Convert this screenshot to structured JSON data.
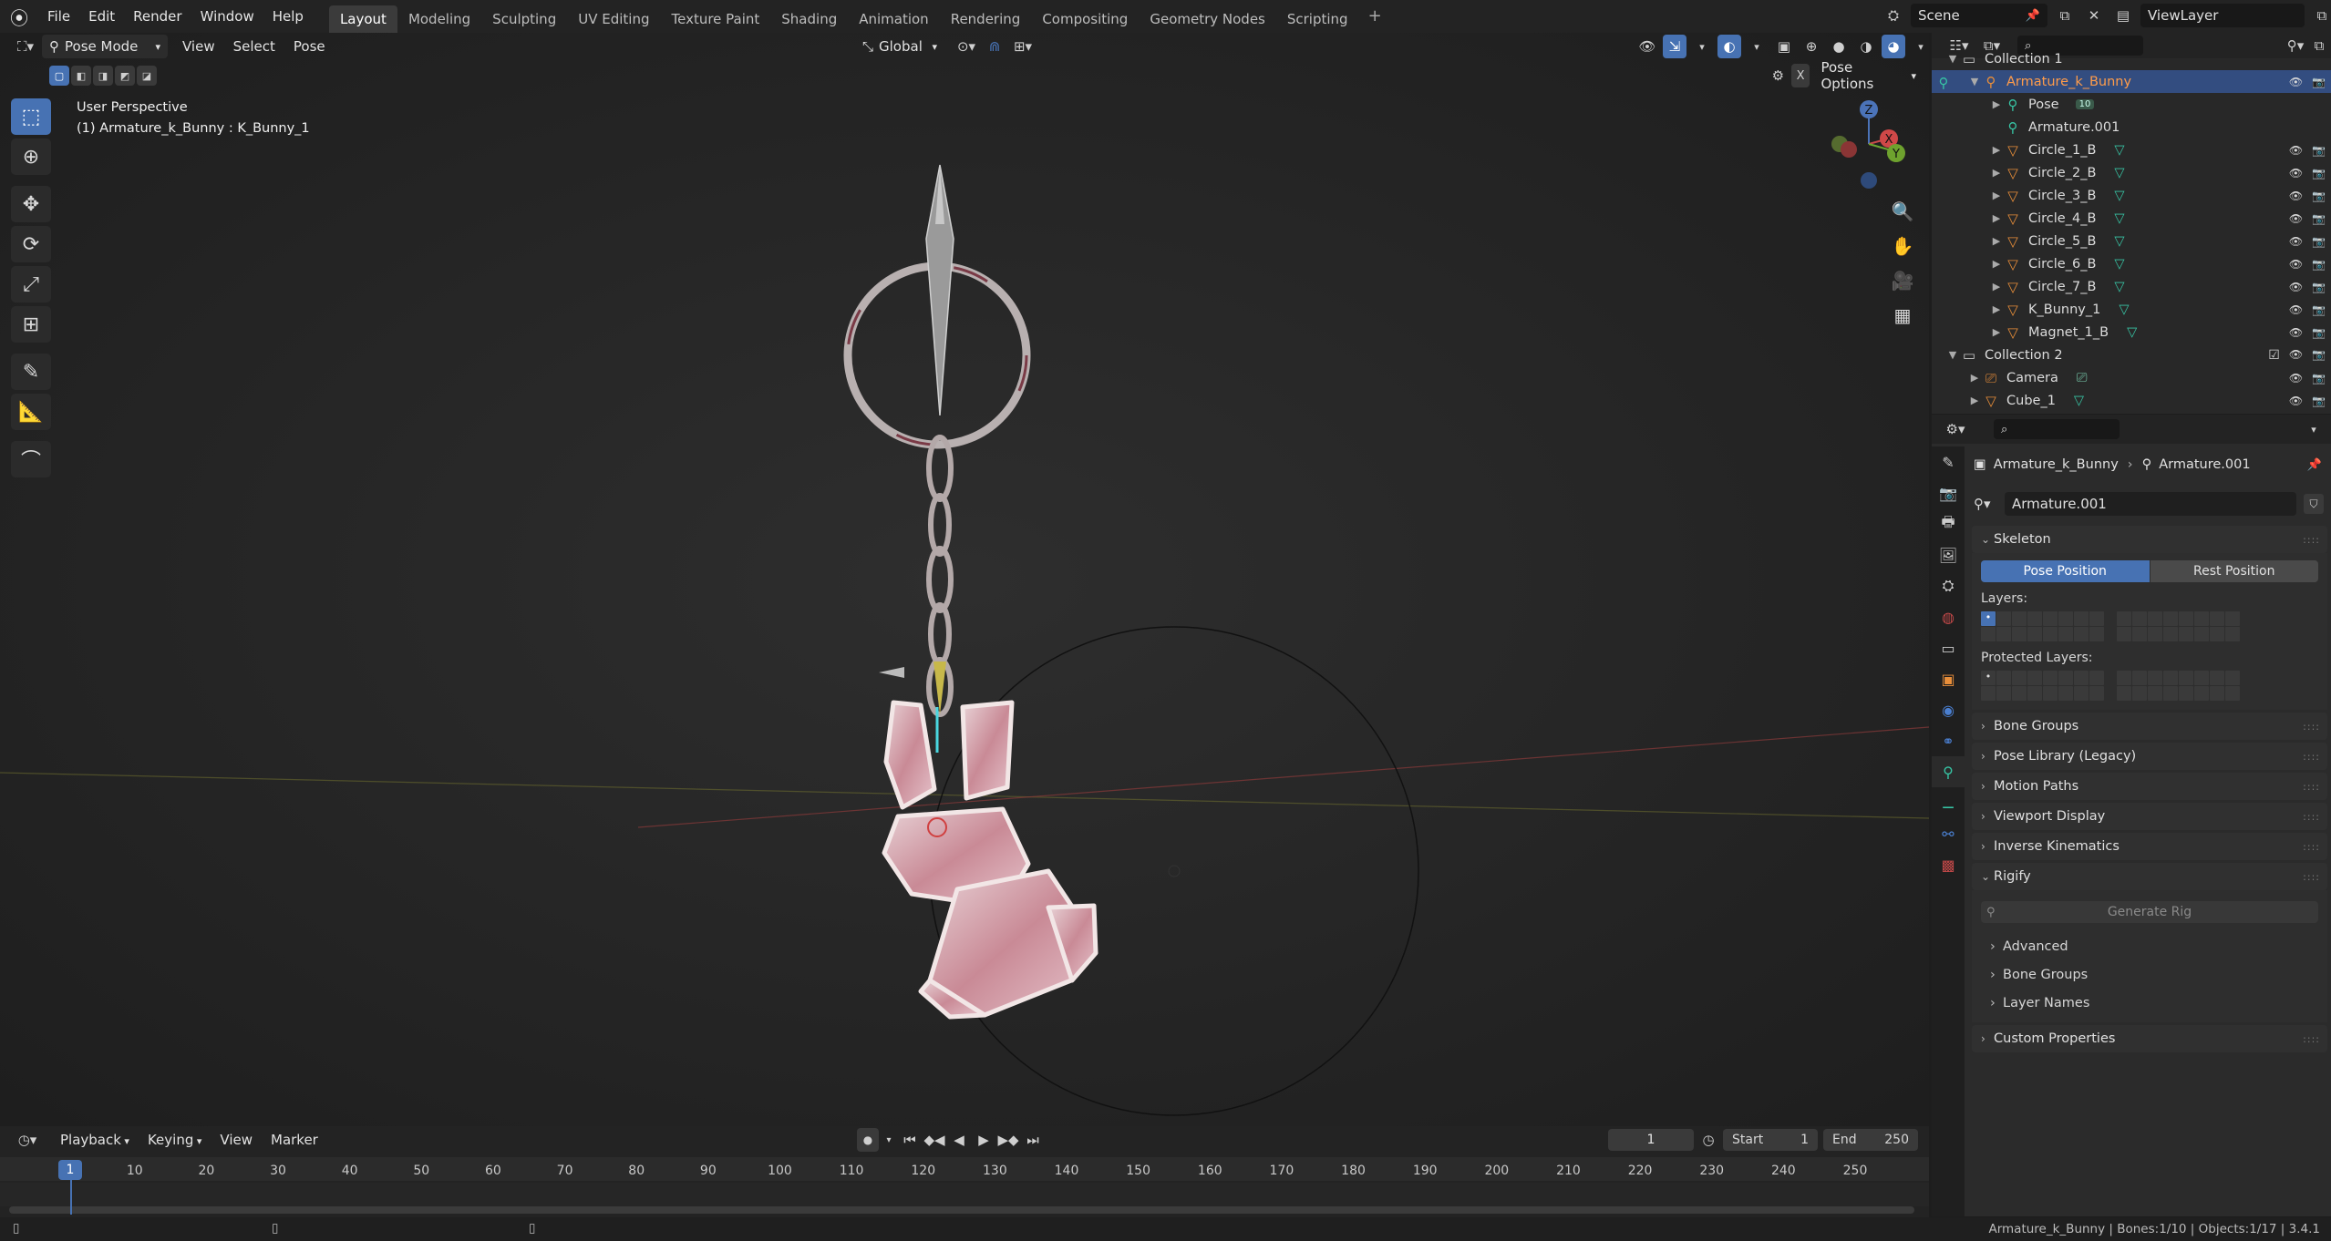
{
  "top_menu": {
    "app_menus": [
      "File",
      "Edit",
      "Render",
      "Window",
      "Help"
    ],
    "workspaces": [
      "Layout",
      "Modeling",
      "Sculpting",
      "UV Editing",
      "Texture Paint",
      "Shading",
      "Animation",
      "Rendering",
      "Compositing",
      "Geometry Nodes",
      "Scripting"
    ],
    "active_workspace": "Layout",
    "add_workspace": "+",
    "scene": "Scene",
    "view_layer": "ViewLayer"
  },
  "viewport": {
    "mode": "Pose Mode",
    "menus": [
      "View",
      "Select",
      "Pose"
    ],
    "orientation": "Global",
    "pose_options": "Pose Options",
    "overlay_title": "User Perspective",
    "overlay_sub": "(1) Armature_k_Bunny : K_Bunny_1",
    "gizmo_axes": {
      "z": "Z",
      "x": "X",
      "y": "Y"
    },
    "x_close": "X"
  },
  "outliner": {
    "items": [
      {
        "label": "Collection 1",
        "indent": 1,
        "icon": "collection"
      },
      {
        "label": "Armature_k_Bunny",
        "indent": 2,
        "icon": "armature",
        "selected": true
      },
      {
        "label": "Pose",
        "indent": 3,
        "icon": "pose",
        "badge": "10"
      },
      {
        "label": "Armature.001",
        "indent": 3,
        "icon": "armature-data"
      },
      {
        "label": "Circle_1_B",
        "indent": 3,
        "icon": "mesh"
      },
      {
        "label": "Circle_2_B",
        "indent": 3,
        "icon": "mesh"
      },
      {
        "label": "Circle_3_B",
        "indent": 3,
        "icon": "mesh"
      },
      {
        "label": "Circle_4_B",
        "indent": 3,
        "icon": "mesh"
      },
      {
        "label": "Circle_5_B",
        "indent": 3,
        "icon": "mesh"
      },
      {
        "label": "Circle_6_B",
        "indent": 3,
        "icon": "mesh"
      },
      {
        "label": "Circle_7_B",
        "indent": 3,
        "icon": "mesh"
      },
      {
        "label": "K_Bunny_1",
        "indent": 3,
        "icon": "mesh"
      },
      {
        "label": "Magnet_1_B",
        "indent": 3,
        "icon": "mesh"
      },
      {
        "label": "Collection 2",
        "indent": 1,
        "icon": "collection"
      },
      {
        "label": "Camera",
        "indent": 2,
        "icon": "camera"
      },
      {
        "label": "Cube_1",
        "indent": 2,
        "icon": "mesh"
      }
    ]
  },
  "properties": {
    "breadcrumb_object": "Armature_k_Bunny",
    "breadcrumb_data": "Armature.001",
    "data_name": "Armature.001",
    "skeleton_label": "Skeleton",
    "pose_position": "Pose Position",
    "rest_position": "Rest Position",
    "layers_label": "Layers:",
    "protected_layers_label": "Protected Layers:",
    "panels": [
      "Bone Groups",
      "Pose Library (Legacy)",
      "Motion Paths",
      "Viewport Display",
      "Inverse Kinematics"
    ],
    "rigify_label": "Rigify",
    "generate_rig": "Generate Rig",
    "rigify_subpanels": [
      "Advanced",
      "Bone Groups",
      "Layer Names"
    ],
    "custom_properties": "Custom Properties"
  },
  "timeline": {
    "menus": [
      "Playback",
      "Keying",
      "View",
      "Marker"
    ],
    "current_frame": "1",
    "start_label": "Start",
    "start_value": "1",
    "end_label": "End",
    "end_value": "250",
    "ticks": [
      "1",
      "10",
      "20",
      "30",
      "40",
      "50",
      "60",
      "70",
      "80",
      "90",
      "100",
      "110",
      "120",
      "130",
      "140",
      "150",
      "160",
      "170",
      "180",
      "190",
      "200",
      "210",
      "220",
      "230",
      "240",
      "250"
    ]
  },
  "statusbar": {
    "info": "Armature_k_Bunny | Bones:1/10 | Objects:1/17 | 3.4.1"
  },
  "colors": {
    "accent": "#4772b3",
    "selection": "#334d80",
    "object_orange": "#e88e3a",
    "data_green": "#37c4a4"
  }
}
